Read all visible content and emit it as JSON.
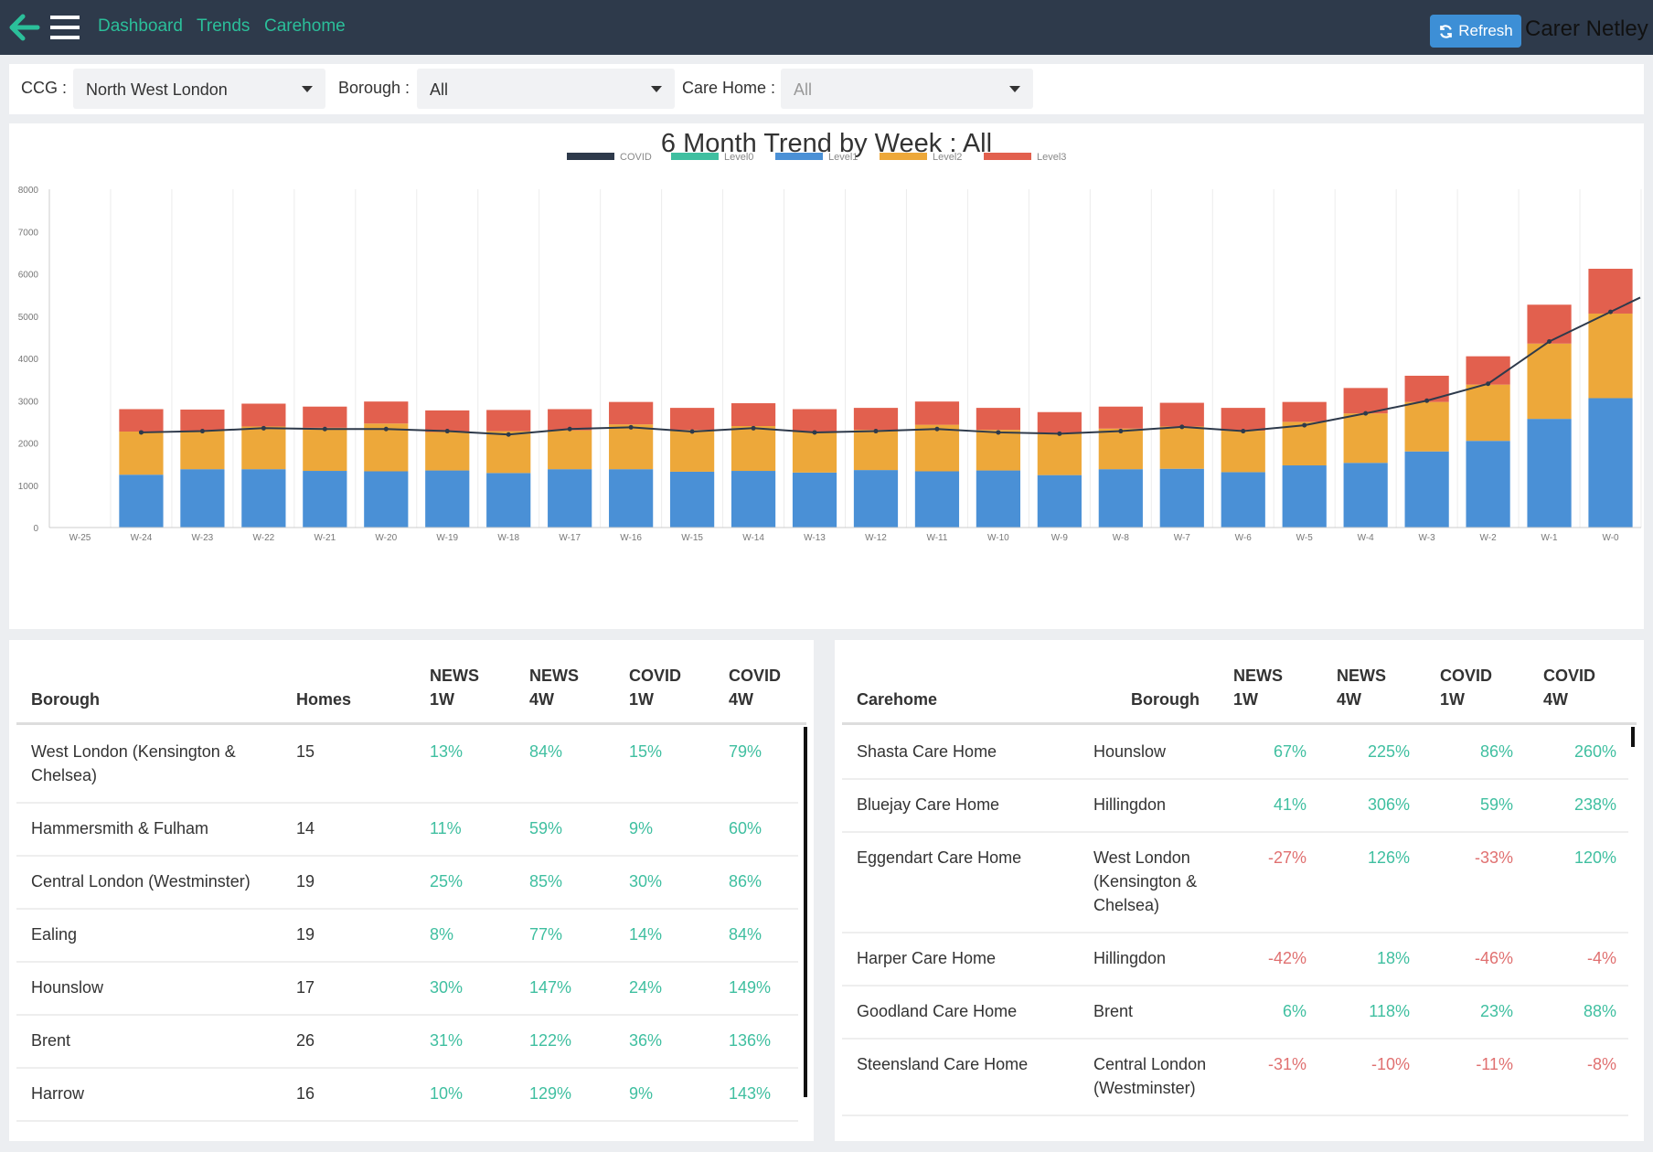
{
  "nav": {
    "links": [
      "Dashboard",
      "Trends",
      "Carehome"
    ],
    "refresh_label": "Refresh",
    "user_name": "Carer Netley"
  },
  "filters": {
    "ccg_label": "CCG :",
    "ccg_value": "North West London",
    "borough_label": "Borough :",
    "borough_value": "All",
    "carehome_label": "Care Home :",
    "carehome_value": "All"
  },
  "chart_data": {
    "type": "bar",
    "title": "6 Month Trend by Week : All",
    "stacked": true,
    "categories": [
      "W-25",
      "W-24",
      "W-23",
      "W-22",
      "W-21",
      "W-20",
      "W-19",
      "W-18",
      "W-17",
      "W-16",
      "W-15",
      "W-14",
      "W-13",
      "W-12",
      "W-11",
      "W-10",
      "W-9",
      "W-8",
      "W-7",
      "W-6",
      "W-5",
      "W-4",
      "W-3",
      "W-2",
      "W-1",
      "W-0"
    ],
    "ylim": [
      0,
      8000
    ],
    "yticks": [
      0,
      1000,
      2000,
      3000,
      4000,
      5000,
      6000,
      7000,
      8000
    ],
    "legend_position": "top-center",
    "grid": true,
    "series": [
      {
        "name": "COVID",
        "kind": "line",
        "color": "#2e3a4b",
        "values": [
          null,
          2250,
          2280,
          2350,
          2330,
          2330,
          2280,
          2200,
          2330,
          2370,
          2270,
          2350,
          2250,
          2280,
          2330,
          2250,
          2220,
          2280,
          2380,
          2280,
          2420,
          2700,
          3000,
          3400,
          4400,
          5100
        ]
      },
      {
        "name": "Level0",
        "kind": "bar",
        "color": "#3fbfa0",
        "values": [
          0,
          0,
          0,
          0,
          0,
          0,
          0,
          0,
          0,
          0,
          0,
          0,
          0,
          0,
          0,
          0,
          0,
          0,
          0,
          0,
          0,
          0,
          0,
          0,
          0,
          0
        ]
      },
      {
        "name": "Level1",
        "kind": "bar",
        "color": "#4a90d6",
        "values": [
          0,
          1250,
          1380,
          1380,
          1340,
          1330,
          1350,
          1290,
          1380,
          1380,
          1320,
          1340,
          1300,
          1360,
          1330,
          1350,
          1240,
          1380,
          1390,
          1310,
          1470,
          1530,
          1800,
          2050,
          2570,
          3060
        ]
      },
      {
        "name": "Level2",
        "kind": "bar",
        "color": "#eda83a",
        "values": [
          0,
          1020,
          910,
          1010,
          1020,
          1130,
          910,
          990,
          920,
          1060,
          990,
          1060,
          960,
          950,
          1100,
          960,
          1000,
          960,
          1000,
          980,
          1030,
          1170,
          1170,
          1330,
          1780,
          2000
        ]
      },
      {
        "name": "Level3",
        "kind": "bar",
        "color": "#e2604e",
        "values": [
          0,
          530,
          500,
          540,
          500,
          520,
          510,
          500,
          500,
          530,
          520,
          540,
          540,
          520,
          550,
          520,
          490,
          520,
          560,
          540,
          470,
          600,
          620,
          670,
          920,
          1060
        ]
      }
    ]
  },
  "borough_table": {
    "columns": [
      {
        "top": "",
        "bottom": "Borough"
      },
      {
        "top": "",
        "bottom": "Homes"
      },
      {
        "top": "NEWS",
        "bottom": "1W"
      },
      {
        "top": "NEWS",
        "bottom": "4W"
      },
      {
        "top": "COVID",
        "bottom": "1W"
      },
      {
        "top": "COVID",
        "bottom": "4W"
      }
    ],
    "rows": [
      {
        "borough": "West London (Kensington & Chelsea)",
        "homes": "15",
        "news1w": "13%",
        "news4w": "84%",
        "covid1w": "15%",
        "covid4w": "79%"
      },
      {
        "borough": "Hammersmith & Fulham",
        "homes": "14",
        "news1w": "11%",
        "news4w": "59%",
        "covid1w": "9%",
        "covid4w": "60%"
      },
      {
        "borough": "Central London (Westminster)",
        "homes": "19",
        "news1w": "25%",
        "news4w": "85%",
        "covid1w": "30%",
        "covid4w": "86%"
      },
      {
        "borough": "Ealing",
        "homes": "19",
        "news1w": "8%",
        "news4w": "77%",
        "covid1w": "14%",
        "covid4w": "84%"
      },
      {
        "borough": "Hounslow",
        "homes": "17",
        "news1w": "30%",
        "news4w": "147%",
        "covid1w": "24%",
        "covid4w": "149%"
      },
      {
        "borough": "Brent",
        "homes": "26",
        "news1w": "31%",
        "news4w": "122%",
        "covid1w": "36%",
        "covid4w": "136%"
      },
      {
        "borough": "Harrow",
        "homes": "16",
        "news1w": "10%",
        "news4w": "129%",
        "covid1w": "9%",
        "covid4w": "143%"
      }
    ]
  },
  "carehome_table": {
    "columns": [
      {
        "top": "",
        "bottom": "Carehome"
      },
      {
        "top": "",
        "bottom": "Borough"
      },
      {
        "top": "NEWS",
        "bottom": "1W"
      },
      {
        "top": "NEWS",
        "bottom": "4W"
      },
      {
        "top": "COVID",
        "bottom": "1W"
      },
      {
        "top": "COVID",
        "bottom": "4W"
      }
    ],
    "rows": [
      {
        "carehome": "Shasta Care Home",
        "borough": "Hounslow",
        "news1w": "67%",
        "news4w": "225%",
        "covid1w": "86%",
        "covid4w": "260%"
      },
      {
        "carehome": "Bluejay Care Home",
        "borough": "Hillingdon",
        "news1w": "41%",
        "news4w": "306%",
        "covid1w": "59%",
        "covid4w": "238%"
      },
      {
        "carehome": "Eggendart Care Home",
        "borough": "West London (Kensington & Chelsea)",
        "news1w": "-27%",
        "news4w": "126%",
        "covid1w": "-33%",
        "covid4w": "120%"
      },
      {
        "carehome": "Harper Care Home",
        "borough": "Hillingdon",
        "news1w": "-42%",
        "news4w": "18%",
        "covid1w": "-46%",
        "covid4w": "-4%"
      },
      {
        "carehome": "Goodland Care Home",
        "borough": "Brent",
        "news1w": "6%",
        "news4w": "118%",
        "covid1w": "23%",
        "covid4w": "88%"
      },
      {
        "carehome": "Steensland Care Home",
        "borough": "Central London (Westminster)",
        "news1w": "-31%",
        "news4w": "-10%",
        "covid1w": "-11%",
        "covid4w": "-8%"
      }
    ]
  }
}
